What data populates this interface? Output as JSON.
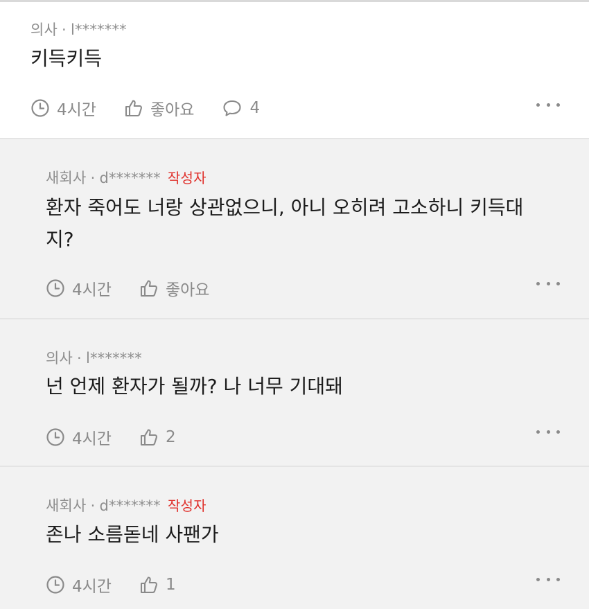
{
  "comments": [
    {
      "type": "main",
      "job": "의사",
      "sep": "·",
      "user": "l*******",
      "badge": "",
      "text": "키득키득",
      "time": "4시간",
      "likes": "좋아요",
      "replies": "4"
    },
    {
      "type": "reply",
      "job": "새회사",
      "sep": "·",
      "user": "d*******",
      "badge": "작성자",
      "text_line1": "환자 죽어도 너랑 상관없으니, 아니 오히려 고소하니 키득대",
      "text_line2": "지?",
      "time": "4시간",
      "likes": "좋아요"
    },
    {
      "type": "reply",
      "job": "의사",
      "sep": "·",
      "user": "l*******",
      "badge": "",
      "text": "넌 언제 환자가 될까? 나 너무 기대돼",
      "time": "4시간",
      "likes": "2"
    },
    {
      "type": "reply",
      "job": "새회사",
      "sep": "·",
      "user": "d*******",
      "badge": "작성자",
      "text": "존나 소름돋네 사팬가",
      "time": "4시간",
      "likes": "1"
    }
  ],
  "icons": {
    "clock": "clock-icon",
    "thumb": "thumbs-up-icon",
    "chat": "comment-bubble-icon",
    "more": "more-dots-icon"
  },
  "colors": {
    "author_badge": "#e0322d",
    "reply_bg": "#f2f2f2",
    "meta_text": "#8e8e8e"
  }
}
